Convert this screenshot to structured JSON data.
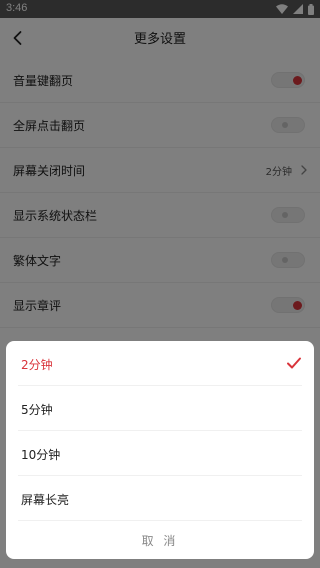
{
  "status_bar": {
    "time": "3:46"
  },
  "header": {
    "title": "更多设置"
  },
  "settings": [
    {
      "label": "音量键翻页",
      "type": "toggle",
      "on": true
    },
    {
      "label": "全屏点击翻页",
      "type": "toggle",
      "on": false
    },
    {
      "label": "屏幕关闭时间",
      "type": "value",
      "value": "2分钟"
    },
    {
      "label": "显示系统状态栏",
      "type": "toggle",
      "on": false
    },
    {
      "label": "繁体文字",
      "type": "toggle",
      "on": false
    },
    {
      "label": "显示章评",
      "type": "toggle",
      "on": true
    }
  ],
  "sheet": {
    "options": [
      {
        "label": "2分钟",
        "selected": true
      },
      {
        "label": "5分钟",
        "selected": false
      },
      {
        "label": "10分钟",
        "selected": false
      },
      {
        "label": "屏幕长亮",
        "selected": false
      }
    ],
    "cancel_label": "取 消"
  },
  "colors": {
    "accent": "#d9343b",
    "overlay": "rgba(0,0,0,0.5)"
  },
  "icons": {
    "back": "back-arrow-icon",
    "check": "check-icon",
    "chevron": "chevron-right-icon"
  }
}
